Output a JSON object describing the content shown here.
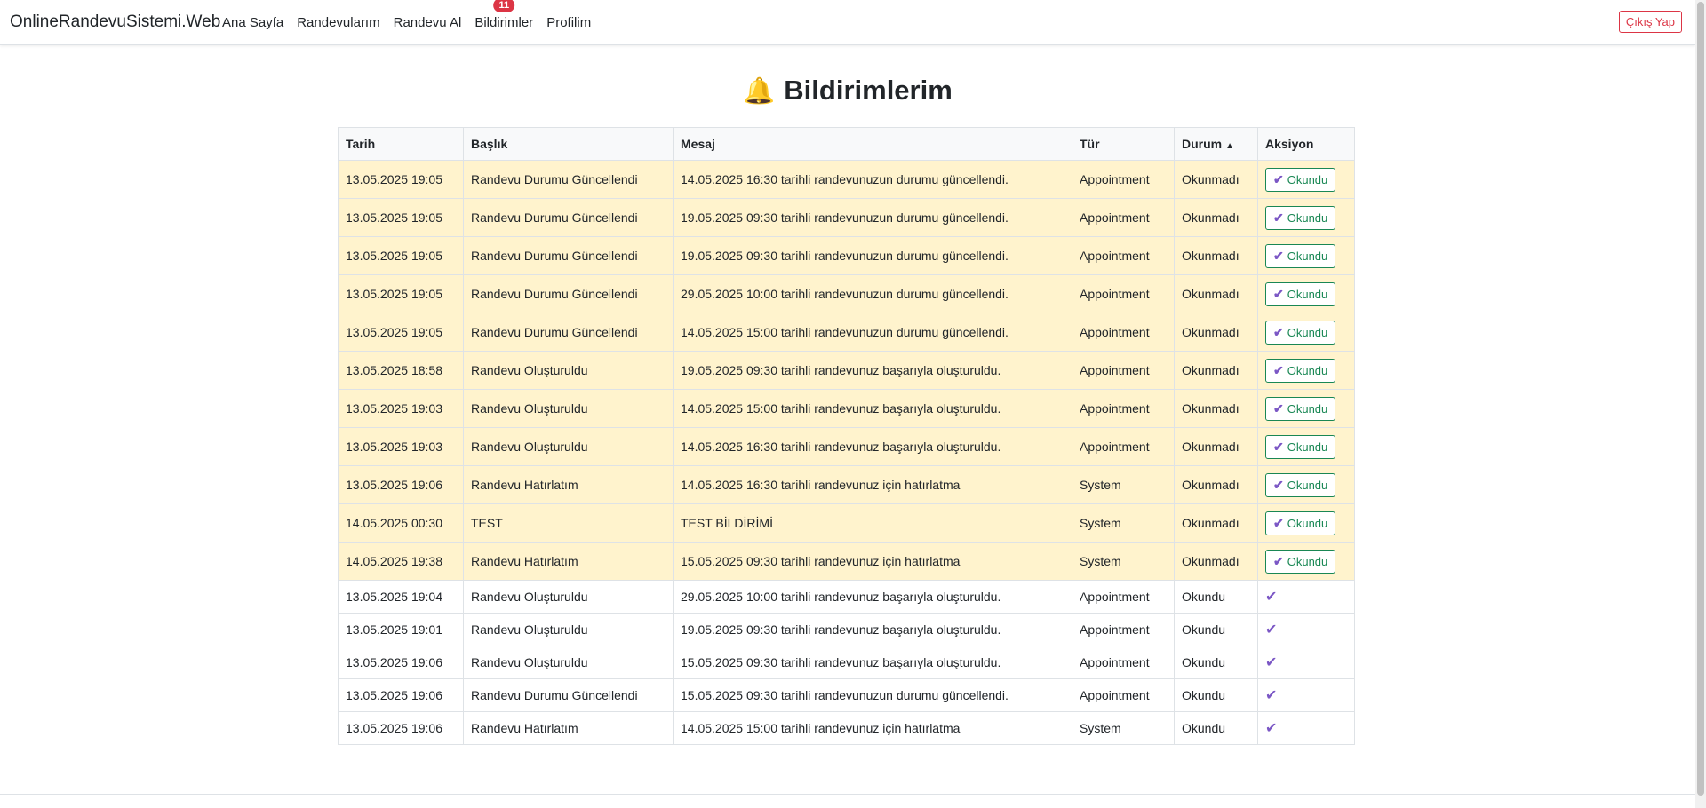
{
  "nav": {
    "brand": "OnlineRandevuSistemi.Web",
    "links": [
      "Ana Sayfa",
      "Randevularım",
      "Randevu Al",
      "Bildirimler",
      "Profilim"
    ],
    "badge_count": "11",
    "logout": "Çıkış Yap"
  },
  "page": {
    "title": "Bildirimlerim",
    "bell_icon": "🔔"
  },
  "table": {
    "headers": [
      "Tarih",
      "Başlık",
      "Mesaj",
      "Tür",
      "Durum",
      "Aksiyon"
    ],
    "sort_indicator": "▲",
    "action_label": "Okundu",
    "check_icon": "✔",
    "rows": [
      {
        "date": "13.05.2025 19:05",
        "title": "Randevu Durumu Güncellendi",
        "message": "14.05.2025 16:30 tarihli randevunuzun durumu güncellendi.",
        "type": "Appointment",
        "status": "Okunmadı",
        "read": false
      },
      {
        "date": "13.05.2025 19:05",
        "title": "Randevu Durumu Güncellendi",
        "message": "19.05.2025 09:30 tarihli randevunuzun durumu güncellendi.",
        "type": "Appointment",
        "status": "Okunmadı",
        "read": false
      },
      {
        "date": "13.05.2025 19:05",
        "title": "Randevu Durumu Güncellendi",
        "message": "19.05.2025 09:30 tarihli randevunuzun durumu güncellendi.",
        "type": "Appointment",
        "status": "Okunmadı",
        "read": false
      },
      {
        "date": "13.05.2025 19:05",
        "title": "Randevu Durumu Güncellendi",
        "message": "29.05.2025 10:00 tarihli randevunuzun durumu güncellendi.",
        "type": "Appointment",
        "status": "Okunmadı",
        "read": false
      },
      {
        "date": "13.05.2025 19:05",
        "title": "Randevu Durumu Güncellendi",
        "message": "14.05.2025 15:00 tarihli randevunuzun durumu güncellendi.",
        "type": "Appointment",
        "status": "Okunmadı",
        "read": false
      },
      {
        "date": "13.05.2025 18:58",
        "title": "Randevu Oluşturuldu",
        "message": "19.05.2025 09:30 tarihli randevunuz başarıyla oluşturuldu.",
        "type": "Appointment",
        "status": "Okunmadı",
        "read": false
      },
      {
        "date": "13.05.2025 19:03",
        "title": "Randevu Oluşturuldu",
        "message": "14.05.2025 15:00 tarihli randevunuz başarıyla oluşturuldu.",
        "type": "Appointment",
        "status": "Okunmadı",
        "read": false
      },
      {
        "date": "13.05.2025 19:03",
        "title": "Randevu Oluşturuldu",
        "message": "14.05.2025 16:30 tarihli randevunuz başarıyla oluşturuldu.",
        "type": "Appointment",
        "status": "Okunmadı",
        "read": false
      },
      {
        "date": "13.05.2025 19:06",
        "title": "Randevu Hatırlatım",
        "message": "14.05.2025 16:30 tarihli randevunuz için hatırlatma",
        "type": "System",
        "status": "Okunmadı",
        "read": false
      },
      {
        "date": "14.05.2025 00:30",
        "title": "TEST",
        "message": "TEST BİLDİRİMİ",
        "type": "System",
        "status": "Okunmadı",
        "read": false
      },
      {
        "date": "14.05.2025 19:38",
        "title": "Randevu Hatırlatım",
        "message": "15.05.2025 09:30 tarihli randevunuz için hatırlatma",
        "type": "System",
        "status": "Okunmadı",
        "read": false
      },
      {
        "date": "13.05.2025 19:04",
        "title": "Randevu Oluşturuldu",
        "message": "29.05.2025 10:00 tarihli randevunuz başarıyla oluşturuldu.",
        "type": "Appointment",
        "status": "Okundu",
        "read": true
      },
      {
        "date": "13.05.2025 19:01",
        "title": "Randevu Oluşturuldu",
        "message": "19.05.2025 09:30 tarihli randevunuz başarıyla oluşturuldu.",
        "type": "Appointment",
        "status": "Okundu",
        "read": true
      },
      {
        "date": "13.05.2025 19:06",
        "title": "Randevu Oluşturuldu",
        "message": "15.05.2025 09:30 tarihli randevunuz başarıyla oluşturuldu.",
        "type": "Appointment",
        "status": "Okundu",
        "read": true
      },
      {
        "date": "13.05.2025 19:06",
        "title": "Randevu Durumu Güncellendi",
        "message": "15.05.2025 09:30 tarihli randevunuzun durumu güncellendi.",
        "type": "Appointment",
        "status": "Okundu",
        "read": true
      },
      {
        "date": "13.05.2025 19:06",
        "title": "Randevu Hatırlatım",
        "message": "14.05.2025 15:00 tarihli randevunuz için hatırlatma",
        "type": "System",
        "status": "Okundu",
        "read": true
      }
    ]
  },
  "colors": {
    "unread_bg": "#fff3cd",
    "success": "#198754",
    "danger": "#dc3545",
    "check": "#7b57c5"
  }
}
